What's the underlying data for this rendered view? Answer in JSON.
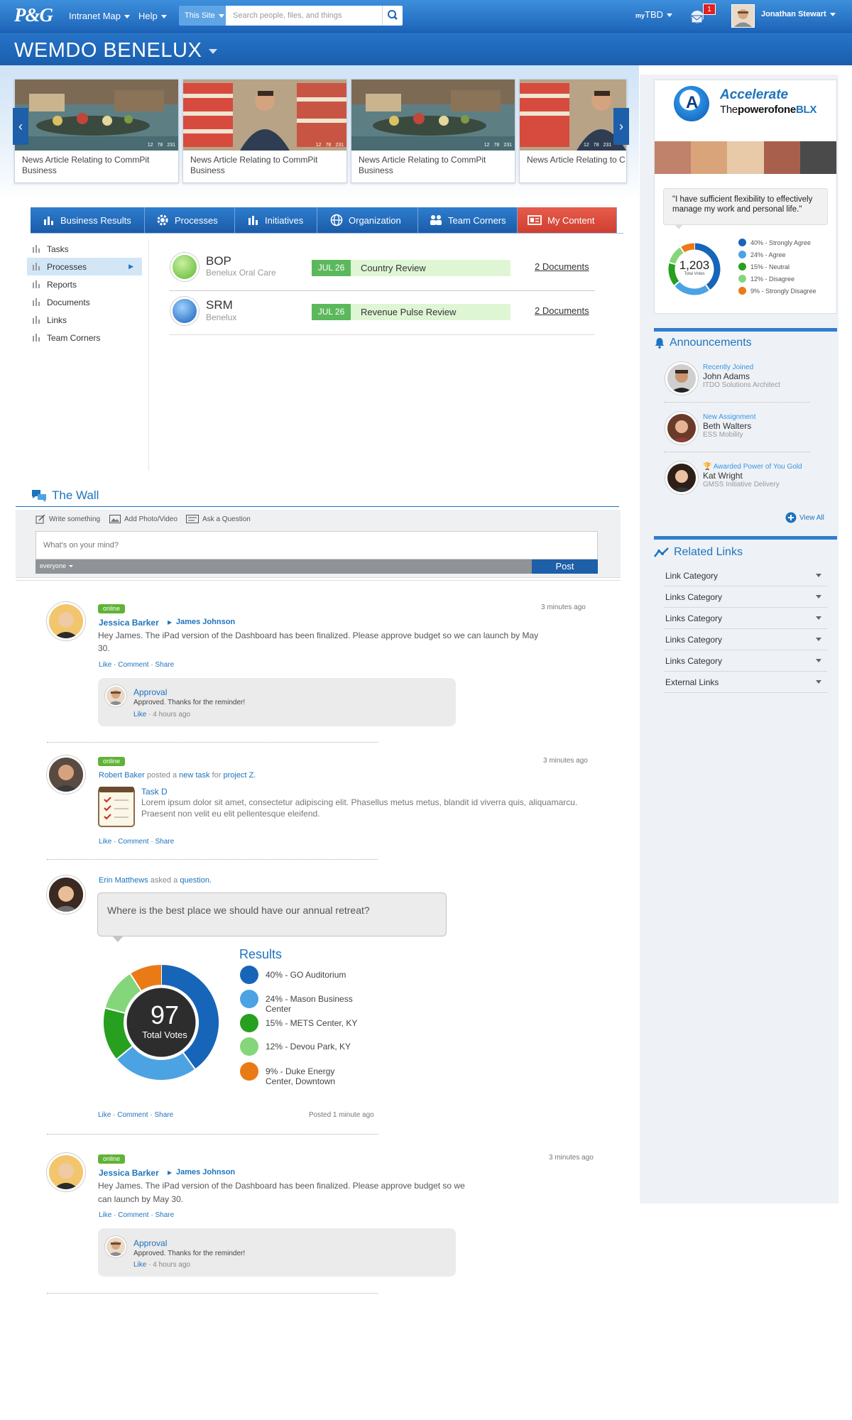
{
  "header": {
    "logo": "P&G",
    "nav": [
      "Intranet Map",
      "Help"
    ],
    "scope": "This Site",
    "search_placeholder": "Search people, files, and things",
    "my_label": "my",
    "my_value": "TBD",
    "notification_count": "1",
    "user_name": "Jonathan Stewart"
  },
  "site": {
    "title": "WEMDO BENELUX"
  },
  "news": [
    {
      "caption": "News Article Relating to CommPit Business",
      "comments": "12",
      "likes": "78",
      "views": "231"
    },
    {
      "caption": "News Article Relating to CommPit Business",
      "comments": "12",
      "likes": "78",
      "views": "231"
    },
    {
      "caption": "News Article Relating to CommPit Business",
      "comments": "12",
      "likes": "78",
      "views": "231"
    },
    {
      "caption": "News Article Relating to C",
      "comments": "12",
      "likes": "78",
      "views": "231"
    }
  ],
  "tabs": [
    "Business Results",
    "Processes",
    "Initiatives",
    "Organization",
    "Team Corners",
    "My Content"
  ],
  "sidemenu": [
    "Tasks",
    "Processes",
    "Reports",
    "Documents",
    "Links",
    "Team Corners"
  ],
  "processes": [
    {
      "name": "BOP",
      "sub": "Benelux Oral Care",
      "date": "JUL 26",
      "event": "Country Review",
      "docs": "2 Documents"
    },
    {
      "name": "SRM",
      "sub": "Benelux",
      "date": "JUL 26",
      "event": "Revenue Pulse Review",
      "docs": "2 Documents"
    }
  ],
  "wall": {
    "title": "The Wall",
    "tabs": [
      "Write something",
      "Add Photo/Video",
      "Ask a Question"
    ],
    "placeholder": "What's on your mind?",
    "audience": "everyone",
    "post_label": "Post"
  },
  "posts": {
    "p1": {
      "status": "online",
      "time": "3 minutes ago",
      "from": "Jessica Barker",
      "to": "James Johnson",
      "text": "Hey James. The iPad version of the Dashboard has been finalized. Please approve budget so we can launch by May 30.",
      "actions": "Like · Comment · Share",
      "reply": {
        "name": "Approval",
        "text": "Approved. Thanks for the reminder!",
        "like": "Like",
        "time": "· 4 hours ago"
      }
    },
    "p2": {
      "status": "online",
      "time": "3 minutes ago",
      "author": "Robert Baker",
      "verb1": " posted a ",
      "obj1": "new task",
      "verb2": " for ",
      "obj2": "project Z.",
      "task_title": "Task D",
      "task_text": "Lorem ipsum dolor sit amet, consectetur adipiscing elit. Phasellus metus metus, blandit id viverra quis, aliquamarcu. Praesent non velit eu elit pellentesque eleifend.",
      "actions": "Like · Comment · Share"
    },
    "p3": {
      "author": "Erin Matthews",
      "verb": " asked a ",
      "obj": "question.",
      "question": "Where is the best place we should have our annual retreat?",
      "results_title": "Results",
      "total": "97",
      "total_label": "Total Votes",
      "actions": "Like · Comment · Share",
      "posted": "Posted 1 minute ago"
    },
    "p4": {
      "status": "online",
      "time": "3 minutes ago",
      "from": "Jessica Barker",
      "to": "James Johnson",
      "text": "Hey James. The iPad version of the Dashboard has been finalized. Please approve budget so we can launch by May 30.",
      "actions": "Like · Comment · Share",
      "reply": {
        "name": "Approval",
        "text": "Approved. Thanks for the reminder!",
        "like": "Like",
        "time": "· 4 hours ago"
      }
    }
  },
  "poll_results": [
    {
      "label": "40% - GO Auditorium",
      "value": 40,
      "color": "#1765b8"
    },
    {
      "label": "24% - Mason Business Center",
      "value": 24,
      "color": "#4ba3e3"
    },
    {
      "label": "15% - METS Center, KY",
      "value": 15,
      "color": "#27a01f"
    },
    {
      "label": "12% - Devou Park, KY",
      "value": 12,
      "color": "#85d67a"
    },
    {
      "label": "9% - Duke Energy Center, Downtown",
      "value": 9,
      "color": "#ea7a16"
    }
  ],
  "accelerate": {
    "title": "Accelerate",
    "tagline_a": "The",
    "tagline_b": "powerofone",
    "tagline_c": "BLX",
    "quote": "\"I have sufficient flexibility to effectively manage my work and personal life.\"",
    "total": "1,203",
    "total_label": "Total Votes",
    "results": [
      {
        "label": "40% - Strongly Agree",
        "value": 40,
        "color": "#1765b8"
      },
      {
        "label": "24% - Agree",
        "value": 24,
        "color": "#4ba3e3"
      },
      {
        "label": "15% - Neutral",
        "value": 15,
        "color": "#27a01f"
      },
      {
        "label": "12% - Disagree",
        "value": 12,
        "color": "#85d67a"
      },
      {
        "label": "9% - Strongly Disagree",
        "value": 9,
        "color": "#ea7a16"
      }
    ]
  },
  "announcements": {
    "title": "Announcements",
    "items": [
      {
        "label": "Recently Joined",
        "name": "John Adams",
        "role": "ITDO Solutions Architect"
      },
      {
        "label": "New Assignment",
        "name": "Beth Walters",
        "role": "ESS Mobility"
      },
      {
        "label": "Awarded Power of You Gold",
        "name": "Kat Wright",
        "role": "GMSS Initiative Delivery"
      }
    ],
    "view_all": "View All"
  },
  "related": {
    "title": "Related Links",
    "items": [
      "Link Category",
      "Links Category",
      "Links Category",
      "Links Category",
      "Links Category",
      "External Links"
    ]
  }
}
